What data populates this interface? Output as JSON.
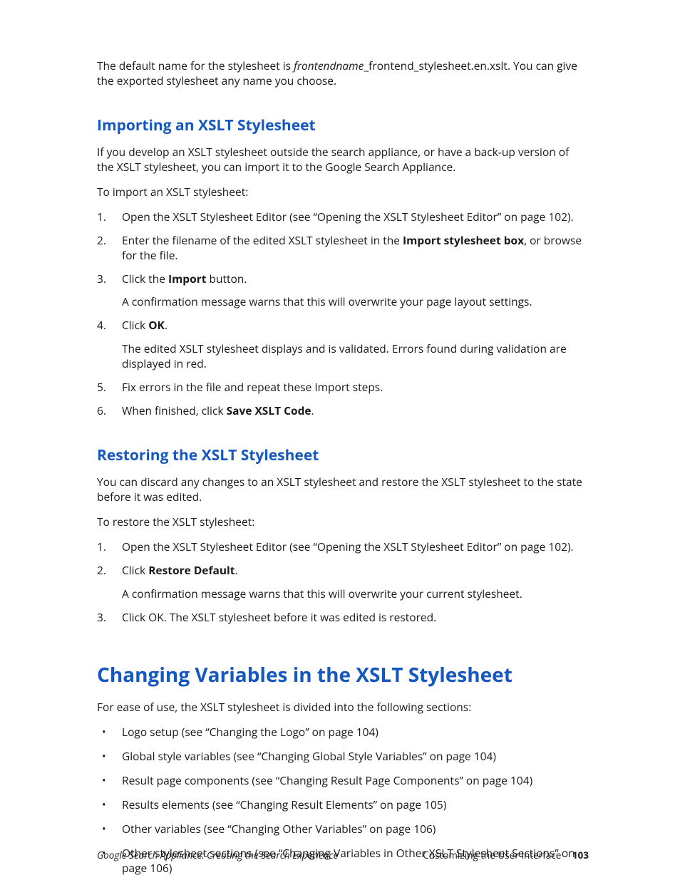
{
  "intro": {
    "p1a": "The default name for the stylesheet is ",
    "p1_italic": "frontendname",
    "p1b": "_frontend_stylesheet.en.xslt. You can give the exported stylesheet any name you choose."
  },
  "sec_import": {
    "heading": "Importing an XSLT Stylesheet",
    "p1": "If you develop an XSLT stylesheet outside the search appliance, or have a back-up version of the XSLT stylesheet, you can import it to the Google Search Appliance.",
    "p2": "To import an XSLT stylesheet:",
    "li1": "Open the XSLT Stylesheet Editor (see “Opening the XSLT Stylesheet Editor” on page 102).",
    "li2a": "Enter the filename of the edited XSLT stylesheet in the ",
    "li2_bold": "Import stylesheet box",
    "li2b": ", or browse for the file.",
    "li3a": "Click the ",
    "li3_bold": "Import",
    "li3b": " button.",
    "li3_sub": "A confirmation message warns that this will overwrite your page layout settings.",
    "li4a": "Click ",
    "li4_bold": "OK",
    "li4b": ".",
    "li4_sub": "The edited XSLT stylesheet displays and is validated. Errors found during validation are displayed in red.",
    "li5": "Fix errors in the file and repeat these Import steps.",
    "li6a": "When finished, click ",
    "li6_bold": "Save XSLT Code",
    "li6b": "."
  },
  "sec_restore": {
    "heading": "Restoring the XSLT Stylesheet",
    "p1": "You can discard any changes to an XSLT stylesheet and restore the XSLT stylesheet to the state before it was edited.",
    "p2": "To restore the XSLT stylesheet:",
    "li1": "Open the XSLT Stylesheet Editor (see “Opening the XSLT Stylesheet Editor” on page 102).",
    "li2a": "Click ",
    "li2_bold": "Restore Default",
    "li2b": ".",
    "li2_sub": "A confirmation message warns that this will overwrite your current stylesheet.",
    "li3": "Click OK. The XSLT stylesheet before it was edited is restored."
  },
  "sec_changing": {
    "heading": "Changing Variables in the XSLT Stylesheet",
    "p1": "For ease of use, the XSLT stylesheet is divided into the following sections:",
    "b1": "Logo setup (see “Changing the Logo” on page 104)",
    "b2": "Global style variables (see “Changing Global Style Variables” on page 104)",
    "b3": "Result page components (see “Changing Result Page Components” on page 104)",
    "b4": "Results elements (see “Changing Result Elements” on page 105)",
    "b5": "Other variables (see “Changing Other Variables” on page 106)",
    "b6": "Other stylesheet sections (see “Changing Variables in Other XSLT Stylesheet Sections” on page 106)"
  },
  "footer": {
    "left": "Google Search Appliance: Creating the Search Experience",
    "right_text": "Customizing the User Interface",
    "page_no": "103"
  }
}
